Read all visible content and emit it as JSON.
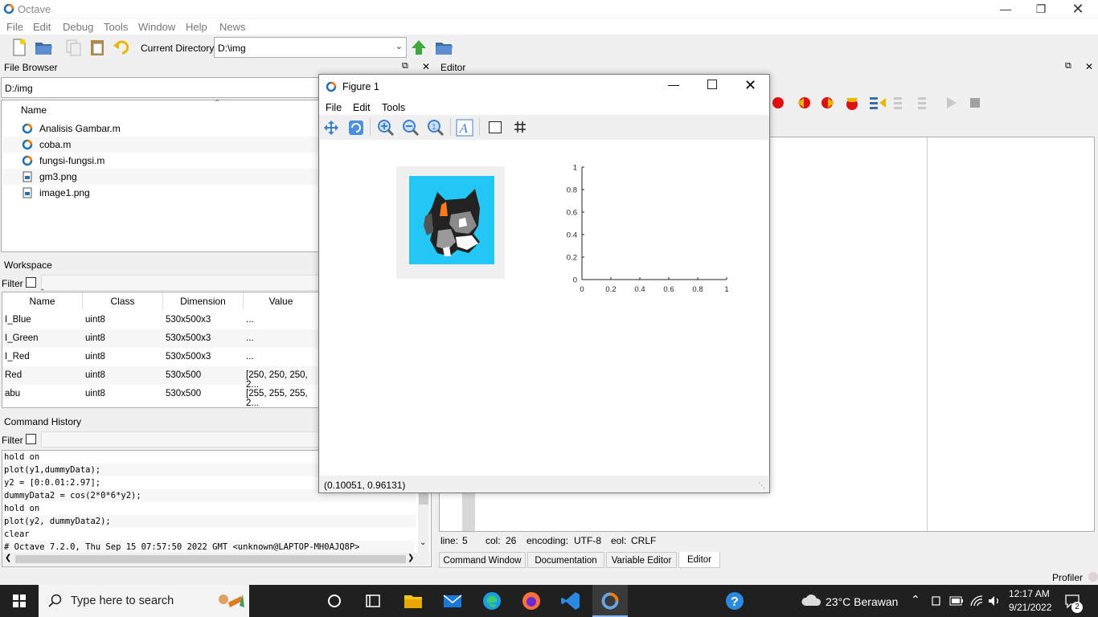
{
  "window": {
    "title": "Octave"
  },
  "menu": [
    "File",
    "Edit",
    "Debug",
    "Tools",
    "Window",
    "Help",
    "News"
  ],
  "toolbar": {
    "current_directory_label": "Current Directory:",
    "current_directory": "D:\\img"
  },
  "file_browser": {
    "title": "File Browser",
    "path": "D:/img",
    "column": "Name",
    "files": [
      {
        "name": "Analisis Gambar.m",
        "icon": "octave-file-icon"
      },
      {
        "name": "coba.m",
        "icon": "octave-file-icon"
      },
      {
        "name": "fungsi-fungsi.m",
        "icon": "octave-file-icon"
      },
      {
        "name": "gm3.png",
        "icon": "image-file-icon"
      },
      {
        "name": "image1.png",
        "icon": "image-file-icon"
      }
    ]
  },
  "editor_dock": {
    "title": "Editor"
  },
  "workspace": {
    "title": "Workspace",
    "filter_label": "Filter",
    "columns": [
      "Name",
      "Class",
      "Dimension",
      "Value"
    ],
    "rows": [
      [
        "I_Blue",
        "uint8",
        "530x500x3",
        "..."
      ],
      [
        "I_Green",
        "uint8",
        "530x500x3",
        "..."
      ],
      [
        "I_Red",
        "uint8",
        "530x500x3",
        "..."
      ],
      [
        "Red",
        "uint8",
        "530x500",
        "[250, 250, 250, 2..."
      ],
      [
        "abu",
        "uint8",
        "530x500",
        "[255, 255, 255, 2..."
      ]
    ]
  },
  "command_history": {
    "title": "Command History",
    "filter_label": "Filter",
    "lines": [
      "hold on",
      "plot(y1,dummyData);",
      "y2 = [0:0.01:2.97];",
      "dummyData2 = cos(2*0*6*y2);",
      "hold on",
      "plot(y2, dummyData2);",
      "clear",
      "# Octave 7.2.0, Thu Sep 15 07:57:50 2022 GMT <unknown@LAPTOP-MH0AJQ8P>"
    ]
  },
  "figure": {
    "title": "Figure 1",
    "menu": [
      "File",
      "Edit",
      "Tools"
    ],
    "status": "(0.10051, 0.96131)"
  },
  "chart_data": {
    "type": "line",
    "title": "",
    "xlabel": "",
    "ylabel": "",
    "xlim": [
      0,
      1
    ],
    "ylim": [
      0,
      1
    ],
    "x_ticks": [
      "0",
      "0.2",
      "0.4",
      "0.6",
      "0.8",
      "1"
    ],
    "y_ticks": [
      "0",
      "0.2",
      "0.4",
      "0.6",
      "0.8",
      "1"
    ],
    "series": []
  },
  "statusbar": {
    "line_label": "line:",
    "line": "5",
    "col_label": "col:",
    "col": "26",
    "encoding_label": "encoding:",
    "encoding": "UTF-8",
    "eol_label": "eol:",
    "eol": "CRLF"
  },
  "bottom_tabs": [
    "Command Window",
    "Documentation",
    "Variable Editor",
    "Editor"
  ],
  "profiler": "Profiler",
  "taskbar": {
    "search_placeholder": "Type here to search",
    "weather": "23°C  Berawan",
    "time": "12:17 AM",
    "date": "9/21/2022",
    "notifications": "2"
  }
}
